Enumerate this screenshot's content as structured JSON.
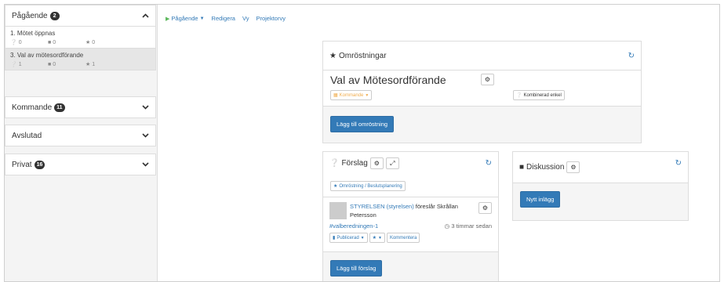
{
  "sidebar": {
    "sections": [
      {
        "label": "Pågående",
        "count": "2",
        "expanded": true
      },
      {
        "label": "Kommande",
        "count": "11",
        "expanded": false
      },
      {
        "label": "Avslutad",
        "count": "",
        "expanded": false
      },
      {
        "label": "Privat",
        "count": "16",
        "expanded": false
      }
    ],
    "items": [
      {
        "title": "1. Mötet öppnas",
        "proposals": "0",
        "comments": "0",
        "votes": "0"
      },
      {
        "title": "3. Val av mötesordförande",
        "proposals": "1",
        "comments": "0",
        "votes": "1"
      }
    ]
  },
  "topnav": {
    "status": "Pågående",
    "edit": "Redigera",
    "view": "Vy",
    "projector": "Projektorvy"
  },
  "polls": {
    "title": "Omröstningar",
    "poll_name": "Val av Mötesordförande",
    "status_tag": "Kommande",
    "method_tag": "Kombinerad enkel",
    "add_button": "Lägg till omröstning"
  },
  "proposals": {
    "title": "Förslag",
    "filter_tag": "Omröstning / Beslutsplanering",
    "author": "STYRELSEN (styrelsen)",
    "text": "föreslår Skrållan Petersson",
    "hashtag": "#valberedningen-1",
    "time": "3 timmar sedan",
    "published_tag": "Publicerad",
    "comment_tag": "Kommentera",
    "add_button": "Lägg till förslag"
  },
  "discussion": {
    "title": "Diskussion",
    "new_post": "Nytt inlägg"
  },
  "colors": {
    "primary": "#337ab7",
    "success": "#5cb85c",
    "warning": "#f0ad4e"
  }
}
